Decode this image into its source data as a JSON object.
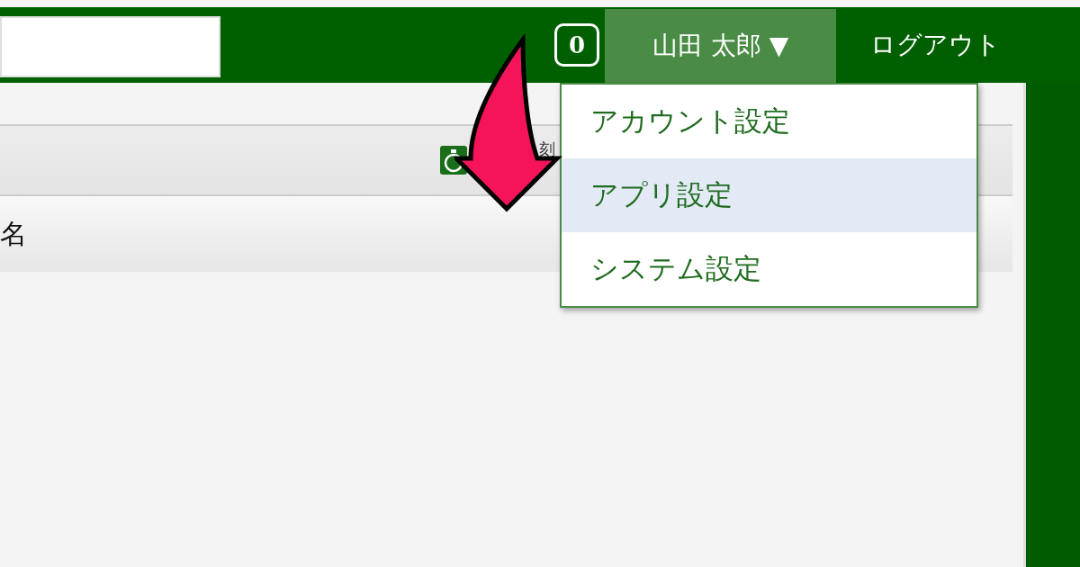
{
  "header": {
    "badge": "0",
    "user_menu": {
      "label": "山田 太郎",
      "caret": "▼",
      "expanded": true
    },
    "logout": "ログアウト"
  },
  "dropdown": [
    {
      "label": "アカウント設定",
      "selected": false
    },
    {
      "label": "アプリ設定",
      "selected": true
    },
    {
      "label": "システム設定",
      "selected": false
    }
  ],
  "panel": {
    "toolbar_label": "刻",
    "column_header": "名"
  }
}
